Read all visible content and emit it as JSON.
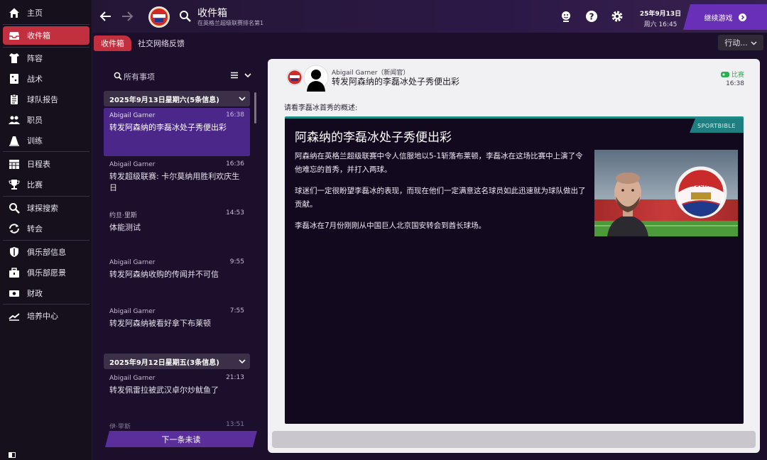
{
  "sidebar": {
    "items": [
      {
        "label": "主页",
        "icon": "home-icon"
      },
      {
        "label": "收件箱",
        "icon": "inbox-icon",
        "active": true
      },
      {
        "label": "阵容",
        "icon": "squad-shirt-icon"
      },
      {
        "label": "战术",
        "icon": "tactics-board-icon"
      },
      {
        "label": "球队报告",
        "icon": "report-clipboard-icon"
      },
      {
        "label": "职员",
        "icon": "staff-people-icon"
      },
      {
        "label": "训练",
        "icon": "training-cone-icon"
      },
      {
        "label": "日程表",
        "icon": "calendar-icon"
      },
      {
        "label": "比赛",
        "icon": "trophy-icon"
      },
      {
        "label": "球探搜索",
        "icon": "scout-search-icon"
      },
      {
        "label": "转会",
        "icon": "transfer-arrows-icon"
      },
      {
        "label": "俱乐部信息",
        "icon": "club-shield-icon"
      },
      {
        "label": "俱乐部愿景",
        "icon": "briefcase-icon"
      },
      {
        "label": "财政",
        "icon": "finance-cash-icon"
      },
      {
        "label": "培养中心",
        "icon": "development-chart-icon"
      }
    ]
  },
  "header": {
    "title": "收件箱",
    "subtitle": "在英格兰超级联赛排名第1",
    "date": "25年9月13日",
    "time": "周六 16:45",
    "continue_label": "继续游戏"
  },
  "tabs": [
    {
      "label": "收件箱",
      "active": true
    },
    {
      "label": "社交网络反馈",
      "active": false
    }
  ],
  "actions_label": "行动...",
  "inbox": {
    "search_placeholder": "所有事项",
    "groups": [
      {
        "date_label": "2025年9月13日星期六(5条信息)",
        "messages": [
          {
            "sender": "Abigail Garner",
            "time": "16:38",
            "subject": "转发阿森纳的李磊冰处子秀便出彩",
            "selected": true
          },
          {
            "sender": "Abigail Garner",
            "time": "16:36",
            "subject": "转发超级联赛: 卡尔莫纳用胜利欢庆生日"
          },
          {
            "sender": "约旦·里斯",
            "time": "14:53",
            "subject": "体能测试"
          },
          {
            "sender": "Abigail Garner",
            "time": "9:55",
            "subject": "转发阿森纳收购的传闻并不可信"
          },
          {
            "sender": "Abigail Garner",
            "time": "7:55",
            "subject": "转发阿森纳被看好拿下布莱顿"
          }
        ]
      },
      {
        "date_label": "2025年9月12日星期五(3条信息)",
        "messages": [
          {
            "sender": "Abigail Garner",
            "time": "21:13",
            "subject": "转发佩雷拉被武汉卓尔炒鱿鱼了"
          },
          {
            "sender": "伊·里斯",
            "time": "13:51",
            "subject": ""
          }
        ]
      }
    ],
    "next_unread_label": "下一条未读"
  },
  "detail": {
    "from": "Abigail Garner（新闻官）",
    "subject": "转发阿森纳的李磊冰处子秀便出彩",
    "tag": "比赛",
    "time": "16:38",
    "intro": "请看李磊冰首秀的概述:",
    "article": {
      "source": "SPORTBIBLE",
      "title": "阿森纳的李磊冰处子秀便出彩",
      "paragraphs": [
        "阿森纳在英格兰超级联赛中令人信服地以5-1斩落布莱顿，李磊冰在这场比赛中上演了令他难忘的首秀，并打入两球。",
        "球迷们一定很盼望李磊冰的表现，而现在他们一定满意这名球员如此迅速就为球队做出了贡献。",
        "李磊冰在7月份刚刚从中国巨人北京国安转会到酋长球场。"
      ],
      "photo_badge_text": "Arsenal"
    }
  },
  "colors": {
    "active_red": "#c2303f",
    "selected_purple": "#4a2788",
    "accent_purple": "#6a2fb8",
    "source_teal": "#1f7f80",
    "match_green": "#2fae52"
  }
}
